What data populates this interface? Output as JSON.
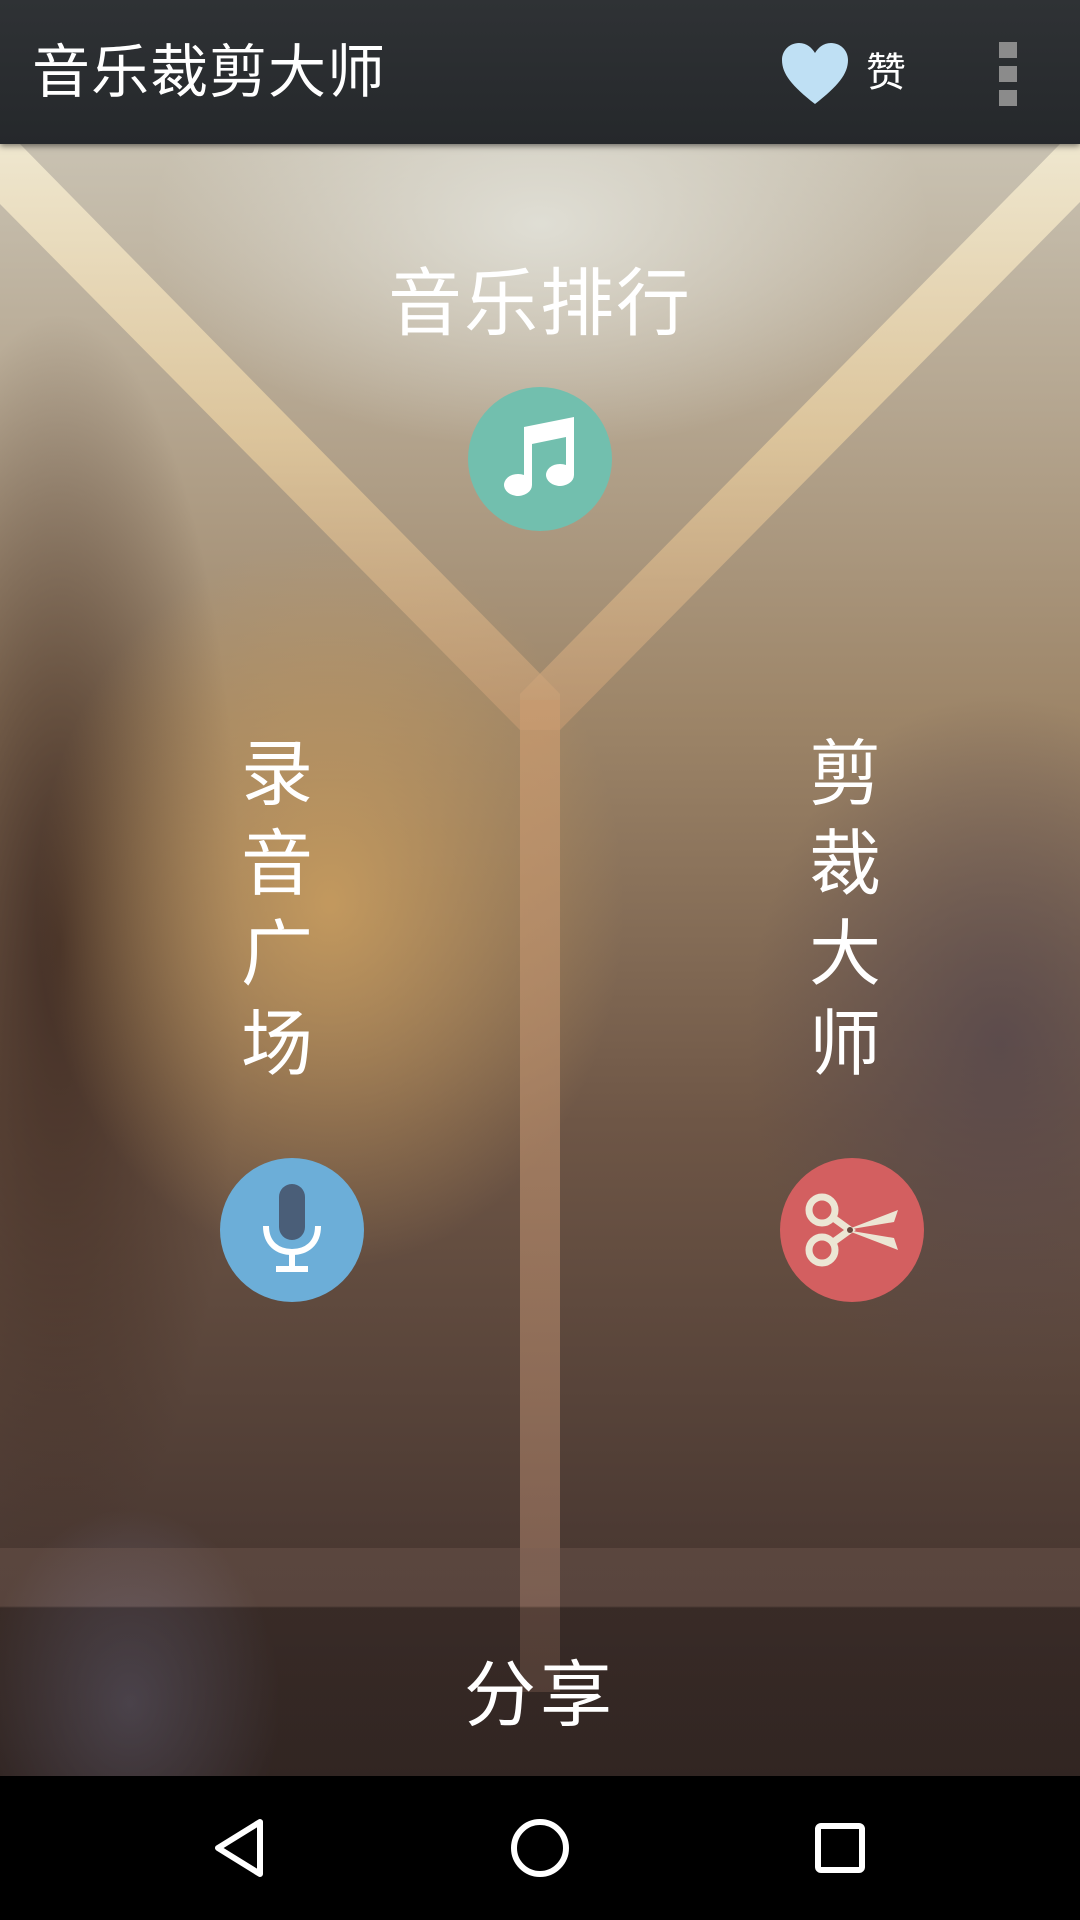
{
  "app_bar": {
    "title": "音乐裁剪大师",
    "like_label": "赞",
    "like_icon": "heart-icon",
    "menu_icon": "overflow-menu-icon"
  },
  "main": {
    "ranking": {
      "label": "音乐排行",
      "icon": "music-note-icon",
      "color": "#72bfae"
    },
    "record_square": {
      "label": "录音广场",
      "icon": "microphone-icon",
      "color": "#6caed8"
    },
    "clip_master": {
      "label": "剪裁大师",
      "icon": "scissors-icon",
      "color": "#d35f60"
    },
    "share": {
      "label": "分享"
    }
  },
  "nav_bar": {
    "back_icon": "back-triangle-icon",
    "home_icon": "home-circle-icon",
    "recent_icon": "recents-square-icon"
  }
}
